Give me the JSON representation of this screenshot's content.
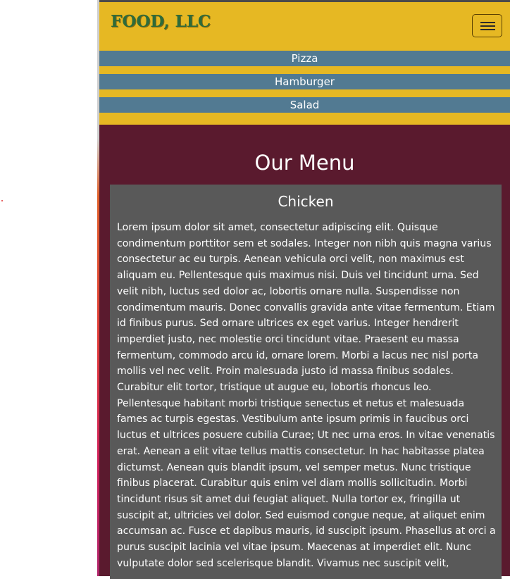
{
  "navbar": {
    "brand": "FOOD, LLC",
    "menu_icon": "hamburger-menu-icon"
  },
  "nav": {
    "items": [
      {
        "label": "Pizza"
      },
      {
        "label": "Hamburger"
      },
      {
        "label": "Salad"
      }
    ]
  },
  "main": {
    "title": "Our Menu",
    "card": {
      "title": "Chicken",
      "body": "Lorem ipsum dolor sit amet, consectetur adipiscing elit. Quisque condimentum porttitor sem et sodales. Integer non nibh quis magna varius consectetur ac eu turpis. Aenean vehicula orci velit, non maximus est aliquam eu. Pellentesque quis maximus nisi. Duis vel tincidunt urna. Sed velit nibh, luctus sed dolor ac, lobortis ornare nulla. Suspendisse non condimentum mauris. Donec convallis gravida ante vitae fermentum. Etiam id finibus purus. Sed ornare ultrices ex eget varius. Integer hendrerit imperdiet justo, nec molestie orci tincidunt vitae. Praesent eu massa fermentum, commodo arcu id, ornare lorem. Morbi a lacus nec nisl porta mollis vel nec velit. Proin malesuada justo id massa finibus sodales. Curabitur elit tortor, tristique ut augue eu, lobortis rhoncus leo. Pellentesque habitant morbi tristique senectus et netus et malesuada fames ac turpis egestas. Vestibulum ante ipsum primis in faucibus orci luctus et ultrices posuere cubilia Curae; Ut nec urna eros. In vitae venenatis erat. Aenean a elit vitae tellus mattis consectetur. In hac habitasse platea dictumst. Aenean quis blandit ipsum, vel semper metus. Nunc tristique finibus placerat. Curabitur quis enim vel diam mollis sollicitudin. Morbi tincidunt risus sit amet dui feugiat aliquet. Nulla tortor ex, fringilla ut suscipit at, ultricies vel dolor. Sed euismod congue neque, at aliquet enim accumsan ac. Fusce et dapibus mauris, id suscipit ipsum. Phasellus at orci a purus suscipit lacinia vel vitae ipsum. Maecenas at imperdiet elit. Nunc vulputate dolor sed scelerisque blandit. Vivamus nec suscipit velit,"
    }
  },
  "colors": {
    "navbar_bg": "#e6b823",
    "nav_item_bg": "#527a92",
    "page_bg": "#5a1a2e",
    "card_bg": "#595959",
    "brand_text": "#2e6b3a"
  }
}
